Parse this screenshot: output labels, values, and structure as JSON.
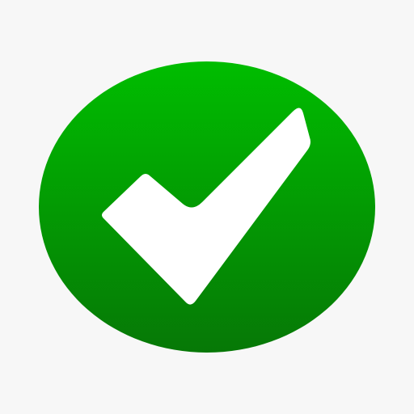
{
  "icon": {
    "name": "checkmark-icon",
    "colors": {
      "background": "#f7f7f7",
      "badge_top": "#00bd00",
      "badge_bottom": "#067806",
      "check": "#ffffff"
    }
  }
}
